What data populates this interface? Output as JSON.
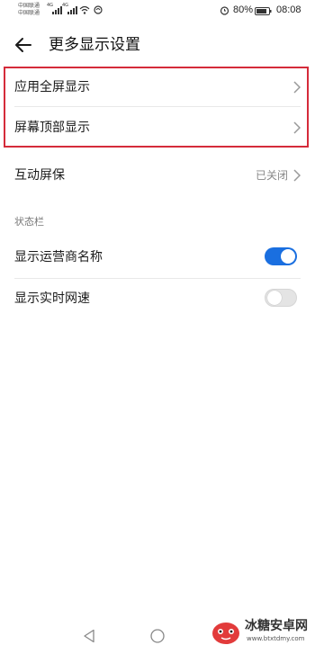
{
  "status_bar": {
    "carrier_1": "中国联通",
    "carrier_2": "中国联通",
    "signal_label_1": "4G",
    "signal_label_2": "4G",
    "battery": "80%",
    "time": "08:08"
  },
  "header": {
    "title": "更多显示设置"
  },
  "settings": {
    "app_fullscreen": "应用全屏显示",
    "screen_top": "屏幕顶部显示",
    "screensaver": "互动屏保",
    "screensaver_value": "已关闭"
  },
  "status_bar_section": {
    "title": "状态栏",
    "items": [
      {
        "label": "显示运营商名称",
        "enabled": true
      },
      {
        "label": "显示实时网速",
        "enabled": false
      }
    ]
  },
  "watermark": {
    "name": "冰糖安卓网",
    "url": "www.btxtdmy.com"
  },
  "colors": {
    "accent": "#1a6fe0",
    "highlight": "#d52b3a"
  }
}
